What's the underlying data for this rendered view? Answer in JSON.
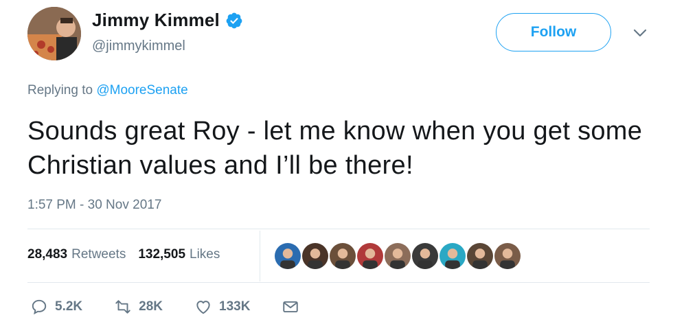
{
  "user": {
    "name": "Jimmy Kimmel",
    "handle": "@jimmykimmel",
    "verified_icon": "verified-badge-icon",
    "avatar_icon": "profile-avatar"
  },
  "header": {
    "follow_label": "Follow",
    "more_icon": "chevron-down-icon"
  },
  "reply": {
    "prefix": "Replying to",
    "target": "@MooreSenate"
  },
  "tweet": {
    "text": "Sounds great Roy - let me know when you get some Christian values and I’ll be there!",
    "timestamp": "1:57 PM - 30 Nov 2017"
  },
  "stats": {
    "retweets_count": "28,483",
    "retweets_label": "Retweets",
    "likes_count": "132,505",
    "likes_label": "Likes"
  },
  "likers": [
    {
      "icon": "liker-avatar-1",
      "color": "#2b6cb0"
    },
    {
      "icon": "liker-avatar-2",
      "color": "#4a3428"
    },
    {
      "icon": "liker-avatar-3",
      "color": "#6b4f3a"
    },
    {
      "icon": "liker-avatar-4",
      "color": "#b03a3a"
    },
    {
      "icon": "liker-avatar-5",
      "color": "#8c6d5a"
    },
    {
      "icon": "liker-avatar-6",
      "color": "#3a3a3a"
    },
    {
      "icon": "liker-avatar-7",
      "color": "#2aa8c4"
    },
    {
      "icon": "liker-avatar-8",
      "color": "#5a4636"
    },
    {
      "icon": "liker-avatar-9",
      "color": "#7a5c48"
    }
  ],
  "actions": {
    "reply_count": "5.2K",
    "retweet_count": "28K",
    "like_count": "133K",
    "reply_icon": "reply-icon",
    "retweet_icon": "retweet-icon",
    "like_icon": "heart-icon",
    "message_icon": "direct-message-icon"
  },
  "colors": {
    "accent": "#1da1f2",
    "muted": "#657786",
    "text": "#14171a",
    "divider": "#e1e8ed"
  }
}
